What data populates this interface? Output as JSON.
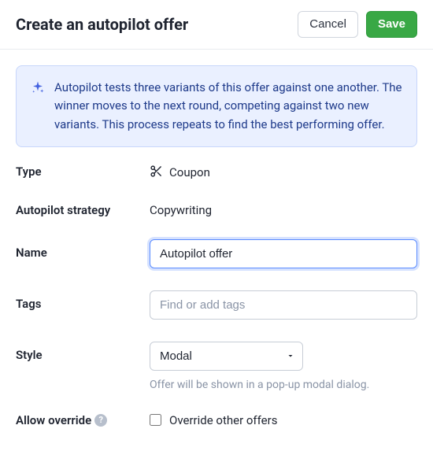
{
  "header": {
    "title": "Create an autopilot offer",
    "cancel": "Cancel",
    "save": "Save"
  },
  "info": {
    "text": "Autopilot tests three variants of this offer against one another. The winner moves to the next round, competing against two new variants. This process repeats to find the best performing offer."
  },
  "form": {
    "type": {
      "label": "Type",
      "value": "Coupon"
    },
    "strategy": {
      "label": "Autopilot strategy",
      "value": "Copywriting"
    },
    "name": {
      "label": "Name",
      "value": "Autopilot offer"
    },
    "tags": {
      "label": "Tags",
      "placeholder": "Find or add tags"
    },
    "style": {
      "label": "Style",
      "selected": "Modal",
      "helper": "Offer will be shown in a pop-up modal dialog."
    },
    "override": {
      "label": "Allow override",
      "checkbox_label": "Override other offers",
      "help_glyph": "?"
    }
  }
}
